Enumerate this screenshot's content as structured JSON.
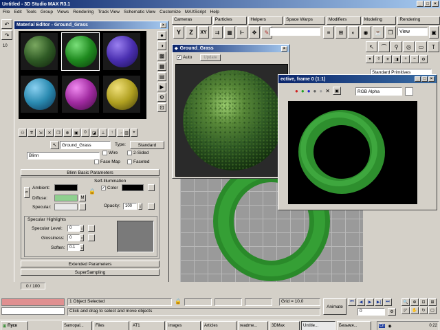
{
  "app": {
    "title": "Untitled - 3D Studio MAX R3.1"
  },
  "menu": [
    "File",
    "Edit",
    "Tools",
    "Group",
    "Views",
    "Rendering",
    "Track View",
    "Schematic View",
    "Customize",
    "MAXScript",
    "Help"
  ],
  "tabs": [
    "Cameras",
    "Particles",
    "Helpers",
    "Space Warps",
    "Modifiers",
    "Modeling",
    "Rendering"
  ],
  "toolbar": {
    "view_select": "View",
    "axis_y": "Y",
    "axis_z": "Z",
    "axis_xy": "XY"
  },
  "command_panel": {
    "primitive_dropdown": "Standard Primitives"
  },
  "material_editor": {
    "title": "Material Editor - Ground_Grass",
    "material_name": "Ground_Grass",
    "type_label": "Type:",
    "type_value": "Standard",
    "shader": "Blinn",
    "wire_label": "Wire",
    "two_sided_label": "2-Sided",
    "face_map_label": "Face Map",
    "faceted_label": "Faceted",
    "basic_params_rollout": "Blinn Basic Parameters",
    "self_illum_group": "Self-Illumination",
    "color_label": "Color",
    "ambient_label": "Ambient:",
    "diffuse_label": "Diffuse:",
    "specular_label": "Specular:",
    "map_button": "M",
    "opacity_label": "Opacity:",
    "opacity_value": "100",
    "spec_highlights_group": "Specular Highlights",
    "spec_level_label": "Specular Level:",
    "spec_level_value": "0",
    "glossiness_label": "Glossiness:",
    "glossiness_value": "0",
    "soften_label": "Soften:",
    "soften_value": "0.1",
    "extended_rollout": "Extended Parameters",
    "supersampling_rollout": "SuperSampling",
    "sphere_colors": [
      "#2f5a25",
      "#1f8a1f",
      "#4a2fb0",
      "#2a8ab0",
      "#a02aa0",
      "#b0a020"
    ]
  },
  "preview_window": {
    "title": "Ground_Grass",
    "auto_label": "Auto",
    "update_button": "Update"
  },
  "render_window": {
    "title": "ective, frame 0 (1:1)",
    "channel_select": "RGB Alpha"
  },
  "viewport": {
    "frame_counter": "0 / 100"
  },
  "status": {
    "selection": "1 Object Selected",
    "prompt": "Click and drag to select and move objects",
    "grid": "Grid = 10,0",
    "animate_button": "Animate",
    "frame_field": "0"
  },
  "taskbar": {
    "start_label": "Пуск",
    "items": [
      "Samopal...",
      "Files",
      "AT1",
      "images",
      "Articles",
      "readme...",
      "3DMax",
      "Untitle...",
      "Безымя..."
    ],
    "lang": "En",
    "clock": "0:22"
  }
}
